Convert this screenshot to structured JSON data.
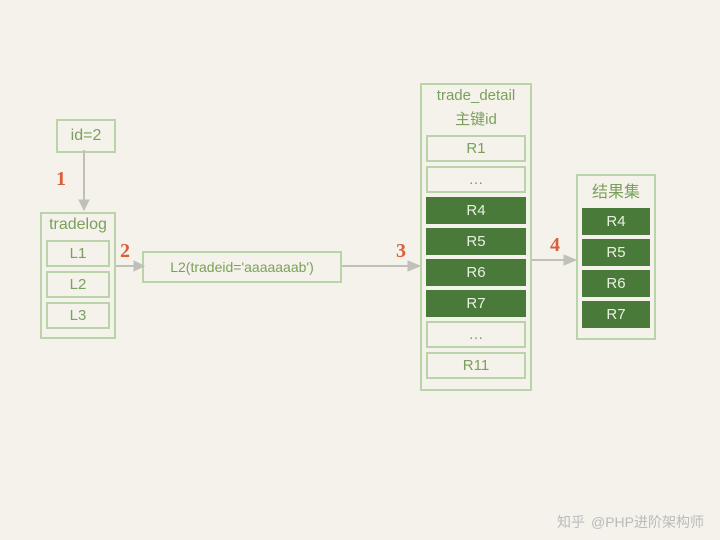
{
  "id_box": {
    "label": "id=2"
  },
  "tradelog": {
    "title": "tradelog",
    "rows": [
      "L1",
      "L2",
      "L3"
    ]
  },
  "filter": {
    "text": "L2(tradeid='aaaaaaab')"
  },
  "trade_detail": {
    "title_line1": "trade_detail",
    "title_line2": "主键id",
    "rows": [
      {
        "label": "R1",
        "filled": false
      },
      {
        "label": "…",
        "filled": false
      },
      {
        "label": "R4",
        "filled": true
      },
      {
        "label": "R5",
        "filled": true
      },
      {
        "label": "R6",
        "filled": true
      },
      {
        "label": "R7",
        "filled": true
      },
      {
        "label": "…",
        "filled": false
      },
      {
        "label": "R11",
        "filled": false
      }
    ]
  },
  "result": {
    "title": "结果集",
    "rows": [
      "R4",
      "R5",
      "R6",
      "R7"
    ]
  },
  "steps": {
    "1": "1",
    "2": "2",
    "3": "3",
    "4": "4"
  },
  "watermark": {
    "brand": "知乎",
    "author": "@PHP进阶架构师"
  }
}
